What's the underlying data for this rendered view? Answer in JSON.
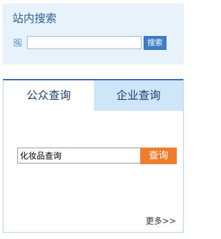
{
  "site_search": {
    "title": "站内搜索",
    "input_value": "",
    "button_label": "搜索"
  },
  "query": {
    "tabs": [
      {
        "label": "公众查询",
        "active": true
      },
      {
        "label": "企业查询",
        "active": false
      }
    ],
    "input_value": "化妆品查询",
    "button_label": "查询",
    "more_label": "更多>>"
  },
  "colors": {
    "panel_bg": "#e8f2fb",
    "title_blue": "#2b5f96",
    "search_button": "#3d7fc6",
    "tab_inactive_bg": "#cfe6fa",
    "panel_top_border": "#2f6fb5",
    "query_button": "#f07c2d"
  },
  "icons": {
    "search": "magnifier-icon"
  }
}
